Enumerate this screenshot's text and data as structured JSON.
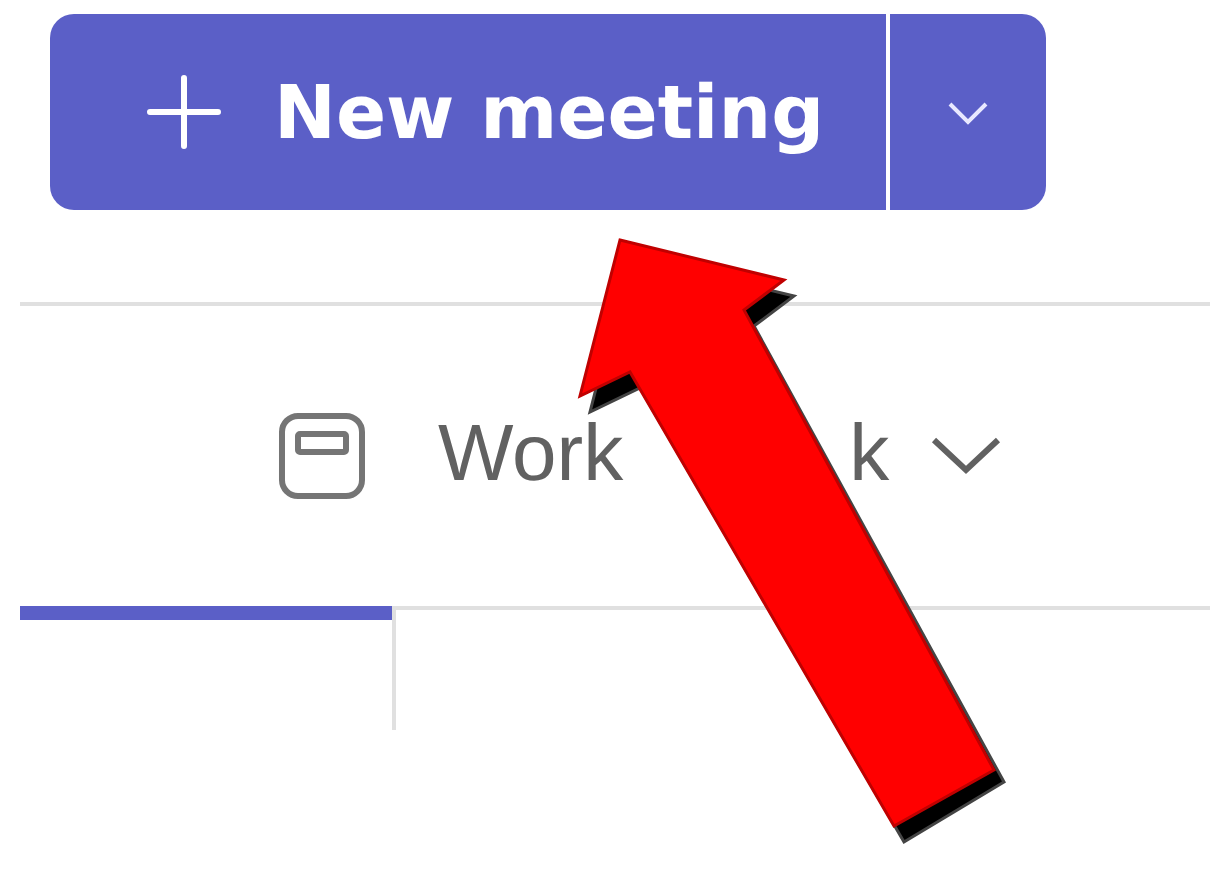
{
  "new_meeting_button": {
    "label": "New meeting"
  },
  "view_picker": {
    "label": "Work",
    "label_tail": "k"
  },
  "day_header": {
    "selected": true
  }
}
